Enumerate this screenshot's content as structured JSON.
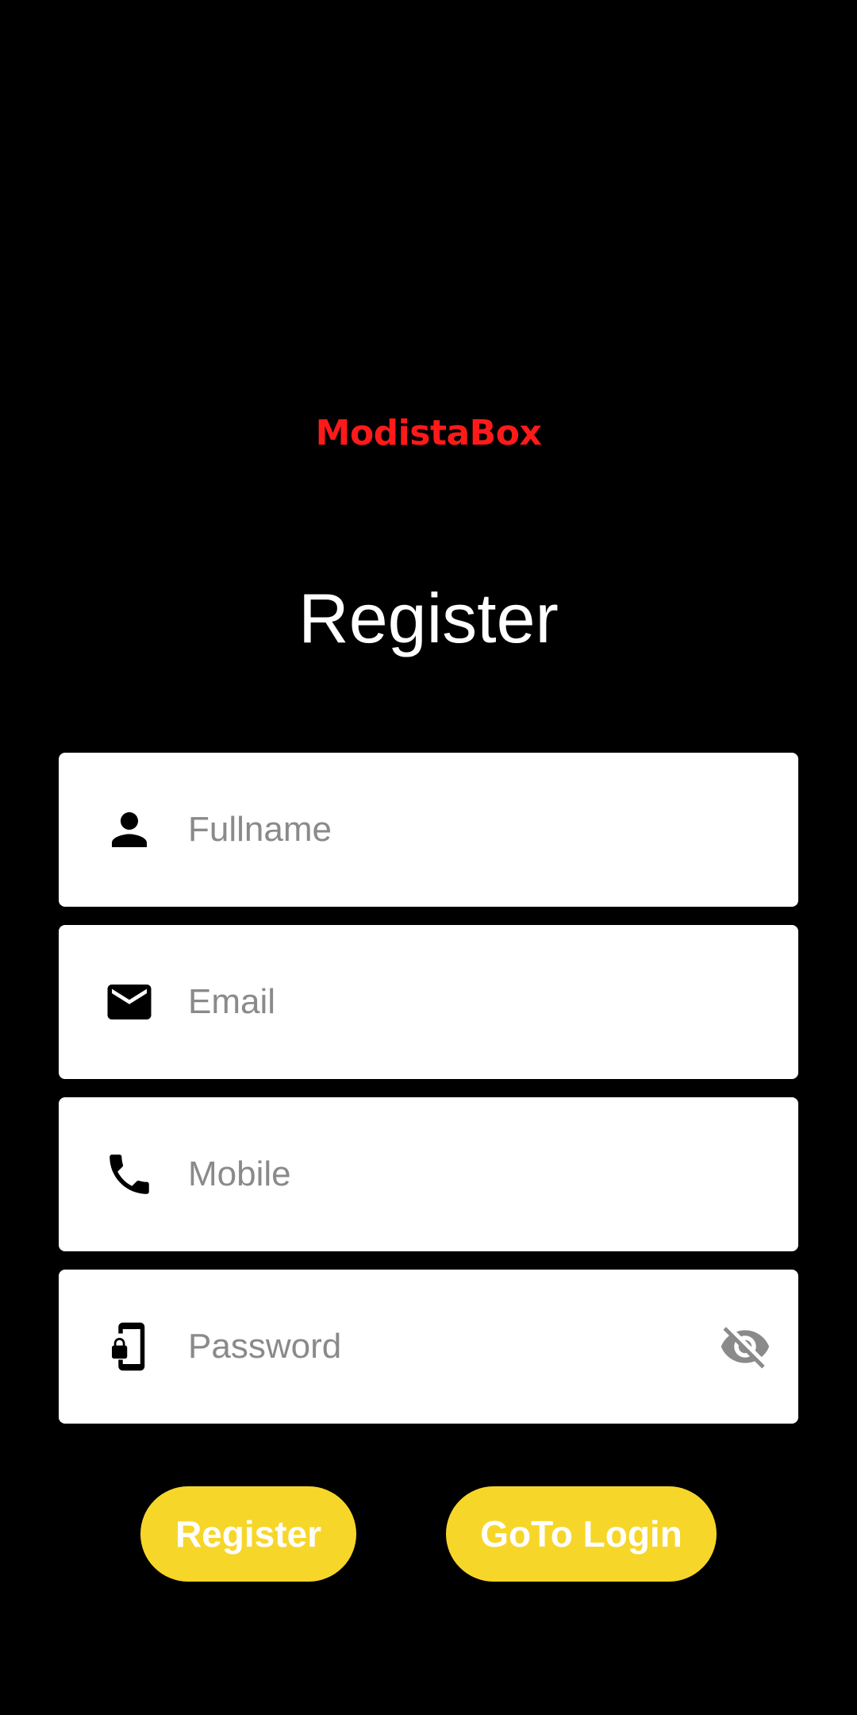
{
  "brand": {
    "name": "ModistaBox",
    "color": "#ff1a1a"
  },
  "page": {
    "title": "Register"
  },
  "form": {
    "fullname": {
      "placeholder": "Fullname",
      "value": "",
      "icon": "person-icon"
    },
    "email": {
      "placeholder": "Email",
      "value": "",
      "icon": "mail-icon"
    },
    "mobile": {
      "placeholder": "Mobile",
      "value": "",
      "icon": "phone-icon"
    },
    "password": {
      "placeholder": "Password",
      "value": "",
      "icon": "phone-lock-icon",
      "toggle_icon": "eye-off-icon"
    }
  },
  "buttons": {
    "register_label": "Register",
    "login_label": "GoTo Login",
    "color": "#f7d62a"
  },
  "theme": {
    "background": "#000000",
    "field_background": "#ffffff",
    "placeholder": "#8a8a8a"
  }
}
